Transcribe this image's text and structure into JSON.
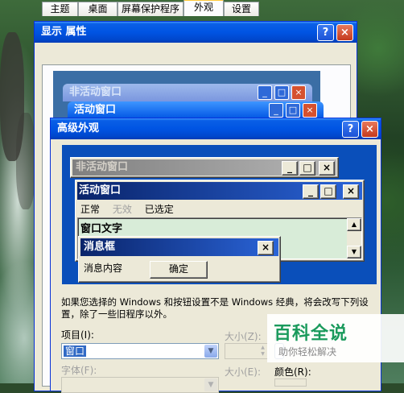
{
  "display_props": {
    "title": "显示 属性",
    "help_glyph": "?",
    "close_glyph": "×",
    "tabs": [
      "主题",
      "桌面",
      "屏幕保护程序",
      "外观",
      "设置"
    ],
    "active_tab": "外观",
    "preview": {
      "inactive_title": "非活动窗口",
      "active_title": "活动窗口"
    }
  },
  "advanced": {
    "title": "高级外观",
    "help_glyph": "?",
    "close_glyph": "×",
    "sample": {
      "inactive_title": "非活动窗口",
      "active_title": "活动窗口",
      "menu": {
        "normal": "正常",
        "disabled": "无效",
        "selected": "已选定"
      },
      "window_text": "窗口文字",
      "msgbox_title": "消息框",
      "msgbox_text": "消息内容",
      "msgbox_ok": "确定",
      "min_glyph": "_",
      "max_glyph": "□",
      "close_glyph": "×",
      "up_glyph": "▲",
      "down_glyph": "▼"
    },
    "note": "如果您选择的 Windows 和按钮设置不是 Windows 经典，将会改写下列设置，除了一些旧程序以外。",
    "item_label": "项目(I):",
    "item_value": "窗口",
    "size_label": "大小(Z):",
    "color_label_1": "颜",
    "font_label": "字体(F):",
    "size_label_2": "大小(E):",
    "color_label_2": "颜色(R):"
  },
  "watermark": {
    "text": "百科全说",
    "sub": "助你轻松解决"
  },
  "colors": {
    "xp_title": "#0054e3",
    "dialog_bg": "#ece9d8",
    "classic_active": "#0a4fba",
    "msg_area": "#d8ecd8"
  }
}
